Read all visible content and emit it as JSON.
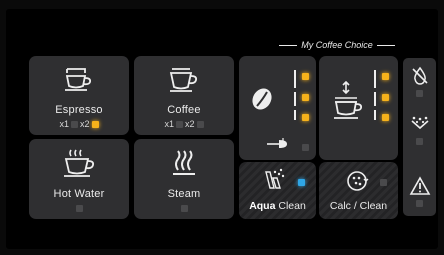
{
  "tiles": {
    "espresso": {
      "label": "Espresso",
      "x1": "x1",
      "x2": "x2"
    },
    "coffee": {
      "label": "Coffee",
      "x1": "x1",
      "x2": "x2"
    },
    "hot_water": {
      "label": "Hot Water"
    },
    "steam": {
      "label": "Steam"
    }
  },
  "my_coffee_choice": {
    "title": "My Coffee Choice"
  },
  "aqua_clean": {
    "bold": "Aqua",
    "rest": " Clean"
  },
  "calc_clean": {
    "label": "Calc / Clean"
  },
  "icons": {
    "espresso": "espresso-cup-icon",
    "coffee": "coffee-cup-icon",
    "hot_water": "hot-water-icon",
    "steam": "steam-icon",
    "aroma": "coffee-bean-icon",
    "volume": "cup-volume-icon",
    "aqua": "water-filter-icon",
    "calc": "descale-icon",
    "water": "no-water-icon",
    "grounds": "grounds-container-icon",
    "warning": "warning-icon"
  },
  "colors": {
    "amber_led": "#f6b21b",
    "blue_led": "#2fa6e6",
    "tile_bg": "#2f2f31"
  },
  "leds": {
    "espresso_x2": "on",
    "aroma_levels": [
      "on",
      "on",
      "on"
    ],
    "volume_levels": [
      "on",
      "on",
      "on"
    ],
    "aqua_clean": "blue"
  }
}
